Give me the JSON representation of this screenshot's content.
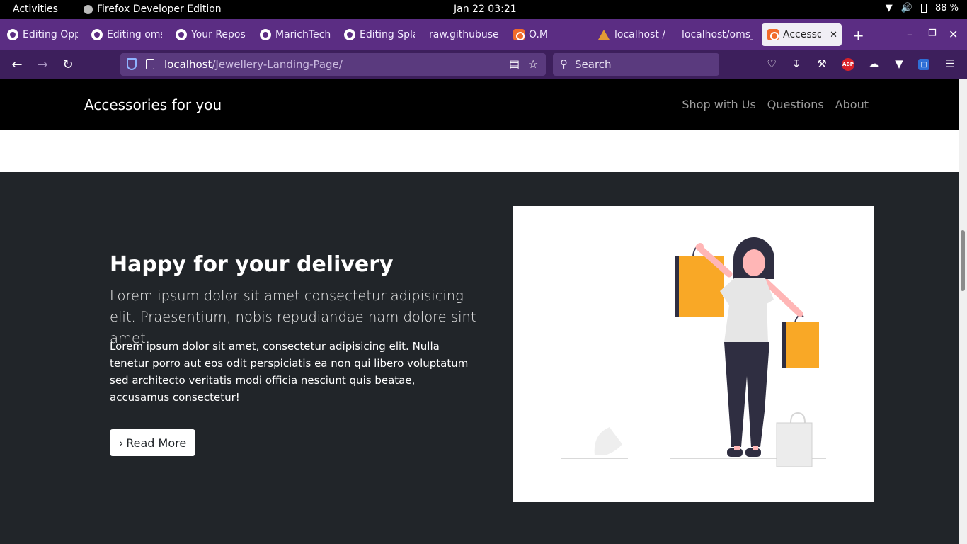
{
  "system": {
    "activities": "Activities",
    "app_name": "Firefox Developer Edition",
    "clock": "Jan 22  03:21",
    "battery": "88 %"
  },
  "tabs": [
    {
      "label": "Editing Opp",
      "icon": "github-icon"
    },
    {
      "label": "Editing oms",
      "icon": "github-icon"
    },
    {
      "label": "Your Repos",
      "icon": "github-icon"
    },
    {
      "label": "MarichTech",
      "icon": "github-icon"
    },
    {
      "label": "Editing Spla",
      "icon": "github-icon"
    },
    {
      "label": "raw.githubuse",
      "icon": "none"
    },
    {
      "label": "O.M",
      "icon": "xampp-icon"
    },
    {
      "label": "localhost / l",
      "icon": "phpmyadmin-icon"
    },
    {
      "label": "localhost/oms_",
      "icon": "none"
    },
    {
      "label": "Accessori",
      "icon": "xampp-icon",
      "active": true
    }
  ],
  "toolbar": {
    "url_host": "localhost",
    "url_path": "/Jewellery-Landing-Page/",
    "search_placeholder": "Search"
  },
  "site": {
    "brand": "Accessories for you",
    "nav": [
      "Shop with Us",
      "Questions",
      "About"
    ]
  },
  "hero": {
    "heading": "Happy for your delivery",
    "lead": "Lorem ipsum dolor sit amet consectetur adipisicing elit. Praesentium, nobis repudiandae nam dolore sint amet.",
    "body": "Lorem ipsum dolor sit amet, consectetur adipisicing elit. Nulla tenetur porro aut eos odit perspiciatis ea non qui libero voluptatum sed architecto veritatis modi officia nesciunt quis beatae, accusamus consectetur!",
    "button": "Read More"
  },
  "colors": {
    "tab_strip": "#5b2d83",
    "nav_bar": "#3d1f5c",
    "site_nav_bg": "#000000",
    "section_bg": "#212529",
    "bag_accent": "#f9a826",
    "figure_dark": "#2f2e41",
    "skin": "#ffb6b6"
  }
}
